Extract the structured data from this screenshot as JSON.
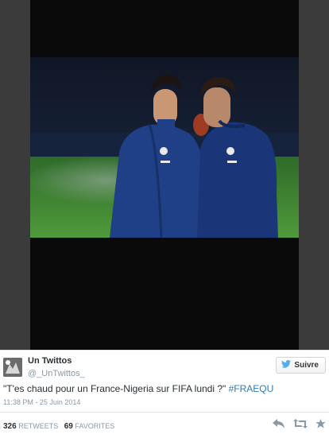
{
  "tweet": {
    "author_name": "Un Twittos",
    "author_handle": "@_UnTwittos_",
    "follow_label": "Suivre",
    "text": "\"T'es chaud pour un France-Nigeria sur FIFA lundi ?\"",
    "hashtag": "#FRAEQU",
    "timestamp": "11:38 PM - 25 Juin 2014",
    "retweets_count": "326",
    "retweets_label": "RETWEETS",
    "favorites_count": "69",
    "favorites_label": "FAVORITES"
  },
  "colors": {
    "link": "#2b7bb9",
    "text": "#292f33",
    "muted": "#8899a6"
  },
  "icons": [
    "twitter-bird-icon",
    "reply-icon",
    "retweet-icon",
    "favorite-icon"
  ]
}
